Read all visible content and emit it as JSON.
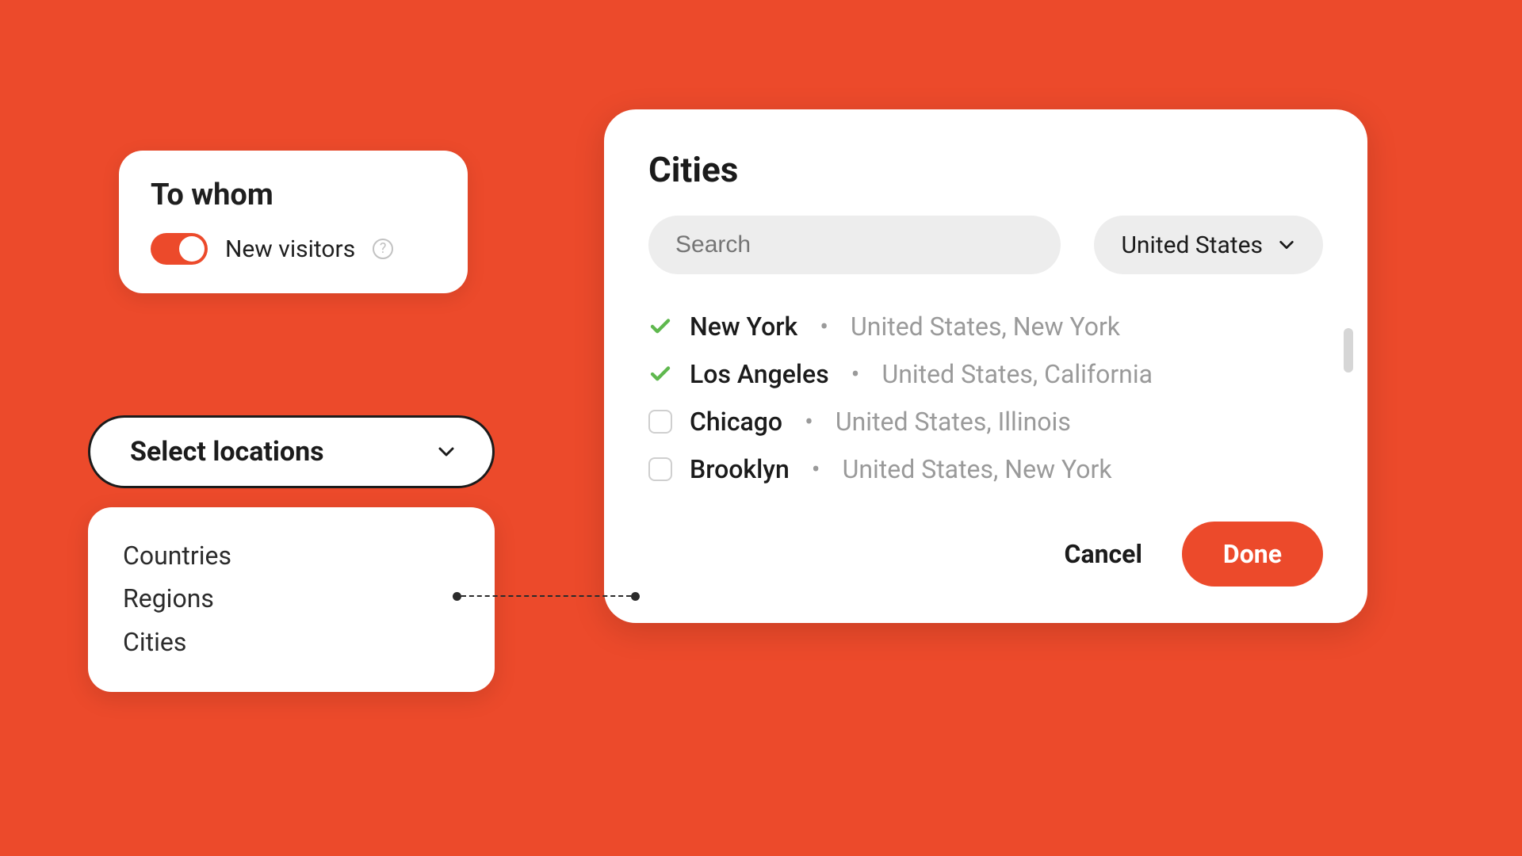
{
  "colors": {
    "accent": "#EC4A2B",
    "check": "#5FB84E"
  },
  "to_whom": {
    "title": "To whom",
    "toggle_on": true,
    "toggle_label": "New visitors",
    "help_symbol": "?"
  },
  "loc_button": {
    "label": "Select locations"
  },
  "loc_options": [
    {
      "label": "Countries"
    },
    {
      "label": "Regions"
    },
    {
      "label": "Cities"
    }
  ],
  "cities_modal": {
    "title": "Cities",
    "search_placeholder": "Search",
    "country_selected": "United States",
    "items": [
      {
        "checked": true,
        "name": "New York",
        "meta": "United States, New York"
      },
      {
        "checked": true,
        "name": "Los Angeles",
        "meta": "United States, California"
      },
      {
        "checked": false,
        "name": "Chicago",
        "meta": "United States, Illinois"
      },
      {
        "checked": false,
        "name": "Brooklyn",
        "meta": "United States, New York"
      }
    ],
    "cancel_label": "Cancel",
    "done_label": "Done",
    "separator": "•"
  }
}
